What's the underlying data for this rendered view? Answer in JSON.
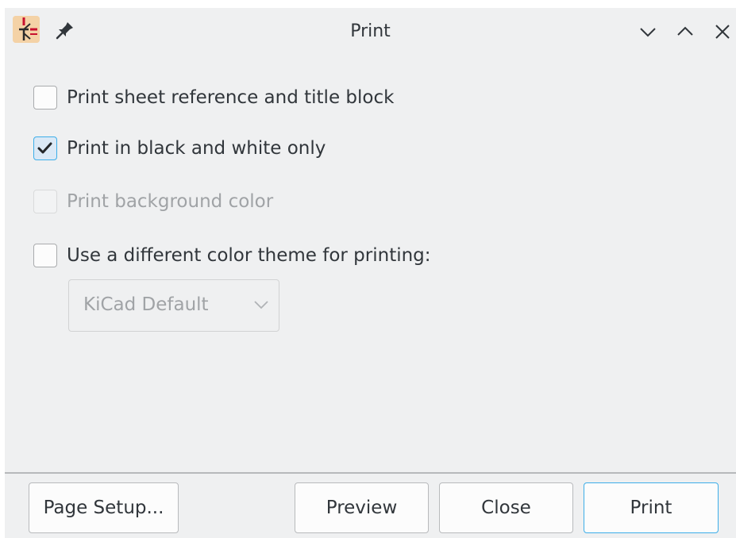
{
  "window": {
    "title": "Print",
    "icons": {
      "app": "kicad-eeschema-icon",
      "pin": "pin-icon",
      "minimize": "chevron-down-icon",
      "maximize": "chevron-up-icon",
      "close": "close-icon"
    }
  },
  "options": {
    "sheet_reference": {
      "label": "Print sheet reference and title block",
      "checked": false,
      "enabled": true
    },
    "black_white": {
      "label": "Print in black and white only",
      "checked": true,
      "enabled": true
    },
    "background_color": {
      "label": "Print background color",
      "checked": false,
      "enabled": false
    },
    "color_theme": {
      "label": "Use a different color theme for printing:",
      "checked": false,
      "enabled": true
    }
  },
  "theme_select": {
    "value": "KiCad Default",
    "enabled": false
  },
  "buttons": {
    "page_setup": "Page Setup...",
    "preview": "Preview",
    "close": "Close",
    "print": "Print"
  },
  "colors": {
    "accent": "#3daee9",
    "window_bg": "#eff0f1",
    "text": "#31363b",
    "disabled_text": "#a0a3a6"
  }
}
